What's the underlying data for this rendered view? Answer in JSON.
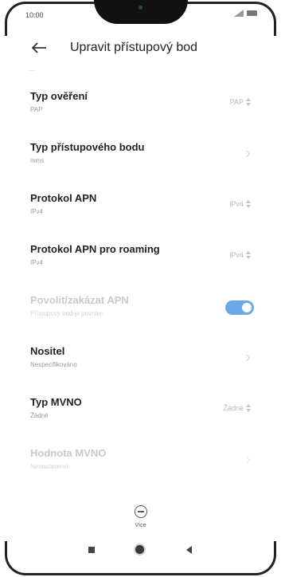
{
  "status_bar": {
    "time": "10:00"
  },
  "header": {
    "title": "Upravit přístupový bod"
  },
  "partial_value": "...",
  "items": [
    {
      "title": "Typ ověření",
      "subtitle": "PAP",
      "value": "PAP",
      "control": "spinner"
    },
    {
      "title": "Typ přístupového bodu",
      "subtitle": "mms",
      "control": "chevron"
    },
    {
      "title": "Protokol APN",
      "subtitle": "IPv4",
      "value": "IPv4",
      "control": "spinner"
    },
    {
      "title": "Protokol APN pro roaming",
      "subtitle": "IPv4",
      "value": "IPv4",
      "control": "spinner"
    },
    {
      "title": "Povolit/zakázat APN",
      "subtitle": "Přístupový bod je povolen",
      "control": "toggle",
      "toggle_on": true,
      "disabled": true
    },
    {
      "title": "Nositel",
      "subtitle": "Nespecifikováno",
      "control": "chevron"
    },
    {
      "title": "Typ MVNO",
      "subtitle": "Žádné",
      "value": "Žádné",
      "control": "spinner"
    },
    {
      "title": "Hodnota MVNO",
      "subtitle": "Nenastaveno",
      "control": "chevron",
      "disabled": true
    }
  ],
  "more": {
    "label": "Více",
    "icon": "minus-circle-icon"
  },
  "colors": {
    "accent": "#6aa8ea",
    "title_text": "#222222",
    "subtitle_text": "#9a9a9a",
    "disabled_text": "#c9c9c9"
  }
}
